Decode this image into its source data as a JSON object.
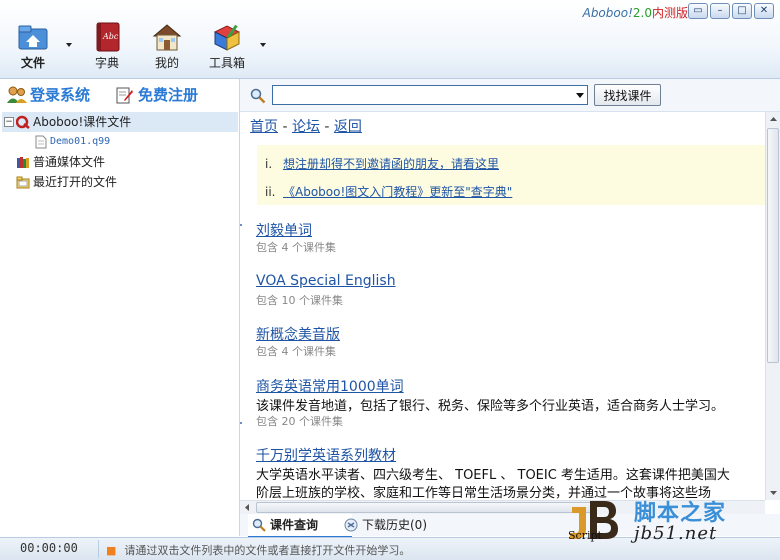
{
  "app": {
    "brand_name": "Aboboo!",
    "brand_version": "2.0",
    "brand_tag": "内测版"
  },
  "window_controls": [
    "restore",
    "minimize",
    "maximize",
    "close"
  ],
  "toolbar": {
    "items": [
      {
        "label": "文件",
        "icon": "folder-home-icon",
        "has_dropdown": true
      },
      {
        "label": "字典",
        "icon": "dictionary-book-icon",
        "has_dropdown": false
      },
      {
        "label": "我的",
        "icon": "house-icon",
        "has_dropdown": false
      },
      {
        "label": "工具箱",
        "icon": "toolbox-icon",
        "has_dropdown": true
      }
    ]
  },
  "left": {
    "login_label": "登录系统",
    "register_label": "免费注册",
    "tree": [
      {
        "label": "Aboboo!课件文件",
        "icon": "aboboo-logo-icon",
        "expanded": true,
        "selected": true
      },
      {
        "label": "Demo01.q99",
        "icon": "document-icon"
      },
      {
        "label": "普通媒体文件",
        "icon": "media-files-icon"
      },
      {
        "label": "最近打开的文件",
        "icon": "recent-folder-icon"
      }
    ]
  },
  "search": {
    "value": "",
    "button_label": "找找课件"
  },
  "nav": {
    "home": "首页",
    "sep1": " - ",
    "forum": "论坛",
    "sep2": " - ",
    "back": "返回"
  },
  "notices": [
    {
      "num": "i.",
      "text": "想注册却得不到邀请函的朋友，请看这里"
    },
    {
      "num": "ii.",
      "text": "《Aboboo!图文入门教程》更新至\"查字典\""
    }
  ],
  "courses": [
    {
      "title": "刘毅单词",
      "desc": "",
      "count": "包含 4 个课件集"
    },
    {
      "title": "VOA Special English",
      "desc": "",
      "count": "包含 10 个课件集"
    },
    {
      "title": "新概念美音版",
      "desc": "",
      "count": "包含 4 个课件集"
    },
    {
      "title": "商务英语常用1000单词",
      "desc": "该课件发音地道，包括了银行、税务、保险等多个行业英语，适合商务人士学习。",
      "count": "包含 20 个课件集"
    },
    {
      "title": "千万别学英语系列教材",
      "desc": "大学英语水平读者、四六级考生、 TOEFL 、 TOEIC 考生适用。这套课件把美国大",
      "desc2": "阶层上班族的学校、家庭和工作等日常生活场景分类，并通过一个故事将这些场",
      "count": ""
    }
  ],
  "bottom_tabs": [
    {
      "label": "课件查询",
      "icon": "search-icon",
      "active": true
    },
    {
      "label": "下载历史(0)",
      "icon": "download-history-icon",
      "active": false
    }
  ],
  "status": {
    "time": "00:00:00",
    "message": "请通过双击文件列表中的文件或者直接打开文件开始学习。"
  },
  "watermark": {
    "script_label": "Script",
    "site_title": "脚本之家",
    "site_url": "jb51.net"
  }
}
